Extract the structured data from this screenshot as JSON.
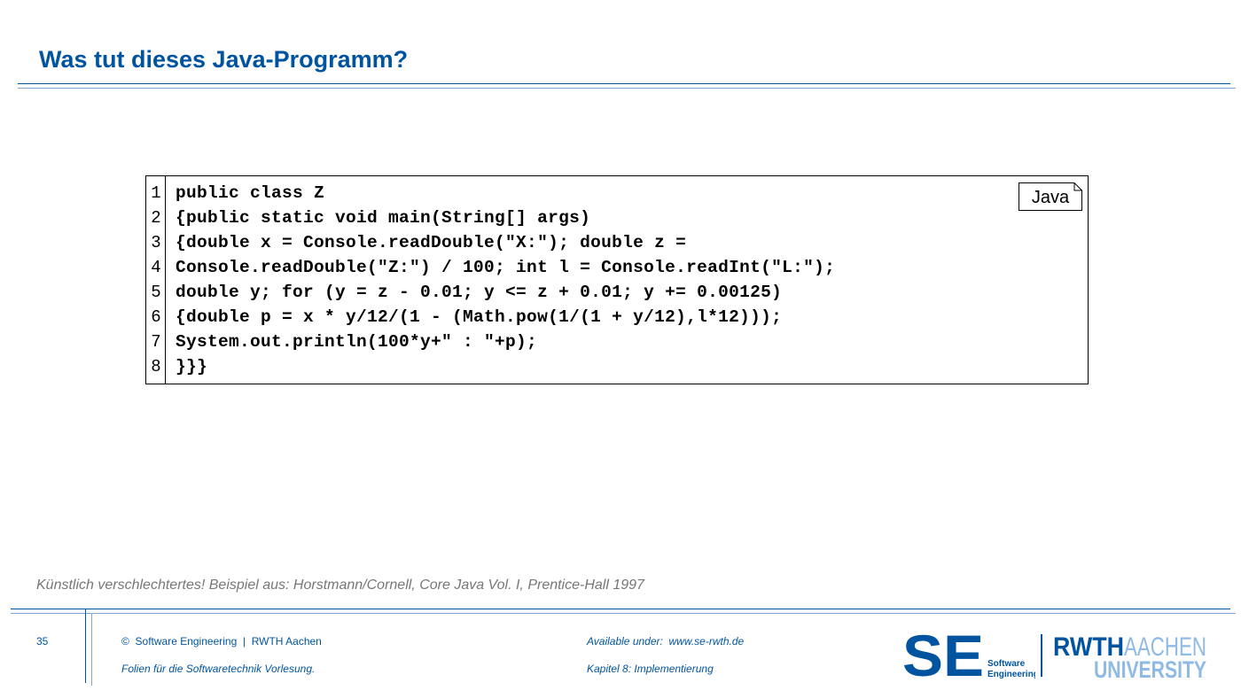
{
  "slide": {
    "title": "Was tut dieses Java-Programm?"
  },
  "code_block": {
    "language_label": "Java",
    "lines": [
      {
        "number": "1",
        "code": "public class Z"
      },
      {
        "number": "2",
        "code": "{public static void main(String[] args)"
      },
      {
        "number": "3",
        "code": "{double x = Console.readDouble(\"X:\"); double z ="
      },
      {
        "number": "4",
        "code": "Console.readDouble(\"Z:\") / 100; int l = Console.readInt(\"L:\");"
      },
      {
        "number": "5",
        "code": "double y; for (y = z - 0.01; y <= z + 0.01; y += 0.00125)"
      },
      {
        "number": "6",
        "code": "{double p = x * y/12/(1 - (Math.pow(1/(1 + y/12),l*12)));"
      },
      {
        "number": "7",
        "code": "System.out.println(100*y+\" : \"+p);"
      },
      {
        "number": "8",
        "code": "}}}"
      }
    ]
  },
  "source_note": "Künstlich verschlechtertes! Beispiel aus: Horstmann/Cornell, Core Java Vol. I,  Prentice-Hall 1997",
  "footer": {
    "page_number": "35",
    "copyright": "©  Software Engineering  |  RWTH Aachen",
    "subtitle": "Folien für die Softwaretechnik Vorlesung.",
    "available": "Available under:  www.se-rwth.de",
    "chapter": "Kapitel 8: Implementierung",
    "logo_se_letters": "SE",
    "logo_se_line1": "Software",
    "logo_se_line2": "Engineering",
    "logo_rwth_main": "RWTH",
    "logo_rwth_sub": "AACHEN",
    "logo_rwth_univ": "UNIVERSITY"
  },
  "colors": {
    "brand_blue": "#00549f",
    "light_blue": "#8ebae5",
    "note_gray": "#777777"
  }
}
